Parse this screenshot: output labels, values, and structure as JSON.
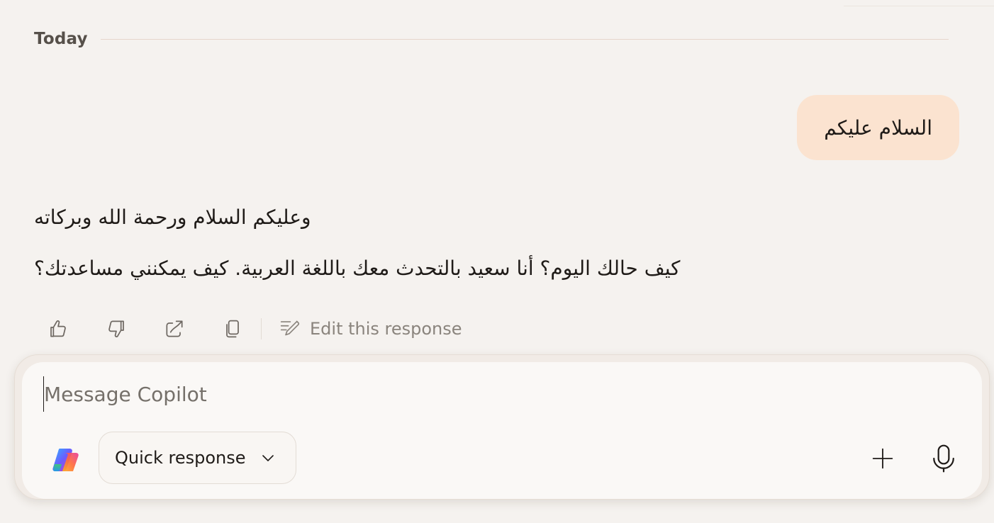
{
  "conversation": {
    "date_label": "Today",
    "user_message": "السلام عليكم",
    "assistant_reply": {
      "line_1": "وعليكم السلام ورحمة الله وبركاته",
      "line_2": "كيف حالك اليوم؟ أنا سعيد بالتحدث معك باللغة العربية. كيف يمكنني مساعدتك؟"
    }
  },
  "actions": {
    "like_icon": "thumbs-up",
    "dislike_icon": "thumbs-down",
    "share_icon": "share",
    "copy_icon": "copy",
    "edit_label": "Edit this response"
  },
  "composer": {
    "placeholder": "Message Copilot",
    "value": "",
    "mode_label": "Quick response",
    "add_icon": "plus",
    "voice_icon": "microphone"
  },
  "colors": {
    "background": "#f5f2ef",
    "user_bubble": "#fbe3d0",
    "text": "#1f1b18",
    "muted": "#8a847d"
  }
}
